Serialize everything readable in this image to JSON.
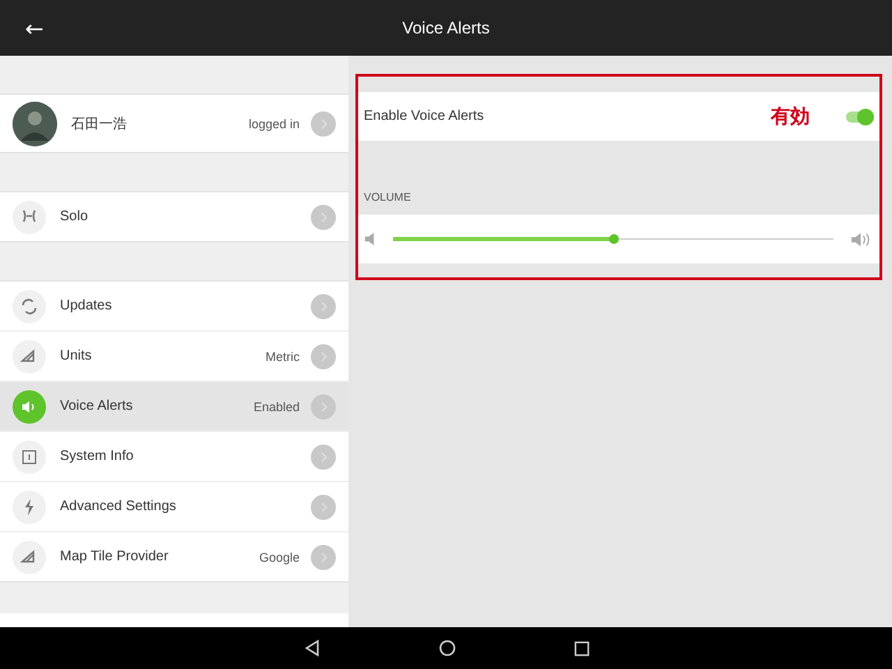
{
  "app_bar": {
    "back": "←",
    "title": "Voice Alerts"
  },
  "profile": {
    "name": "石田一浩",
    "status": "logged in"
  },
  "groups": [
    [
      {
        "kind": "solo",
        "label": "Solo",
        "selected": false
      }
    ],
    [
      {
        "kind": "updates",
        "label": "Updates",
        "selected": false
      },
      {
        "kind": "units",
        "label": "Units",
        "value": "Metric",
        "selected": false
      },
      {
        "kind": "voice",
        "label": "Voice Alerts",
        "value": "Enabled",
        "selected": true
      },
      {
        "kind": "info",
        "label": "System Info",
        "selected": false
      },
      {
        "kind": "advanced",
        "label": "Advanced Settings",
        "selected": false
      },
      {
        "kind": "map",
        "label": "Map Tile Provider",
        "value": "Google",
        "selected": false
      }
    ]
  ],
  "detail": {
    "enable_label": "Enable Voice Alerts",
    "enabled": true,
    "annotation": "有効",
    "volume_label": "VOLUME",
    "volume": {
      "level": 0.5
    }
  }
}
